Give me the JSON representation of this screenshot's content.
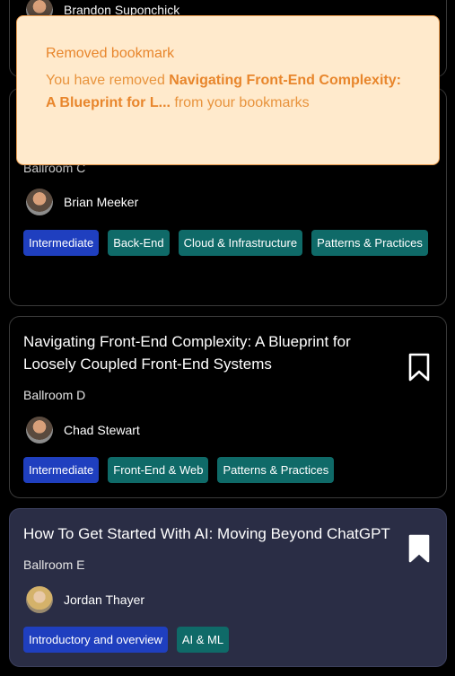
{
  "top_card": {
    "speaker": "Brandon Suponchick"
  },
  "card2": {
    "room": "Ballroom C",
    "speaker": "Brian Meeker",
    "tags": [
      {
        "label": "Intermediate",
        "color": "blue"
      },
      {
        "label": "Back-End",
        "color": "teal"
      },
      {
        "label": "Cloud & Infrastructure",
        "color": "teal"
      },
      {
        "label": "Patterns & Practices",
        "color": "teal"
      }
    ]
  },
  "card3": {
    "title": "Navigating Front-End Complexity: A Blueprint for Loosely Coupled Front-End Systems",
    "room": "Ballroom D",
    "speaker": "Chad Stewart",
    "bookmarked": false,
    "tags": [
      {
        "label": "Intermediate",
        "color": "blue"
      },
      {
        "label": "Front-End & Web",
        "color": "teal"
      },
      {
        "label": "Patterns & Practices",
        "color": "teal"
      }
    ]
  },
  "card4": {
    "title": "How To Get Started With AI: Moving Beyond ChatGPT",
    "room": "Ballroom E",
    "speaker": "Jordan Thayer",
    "bookmarked": true,
    "tags": [
      {
        "label": "Introductory and overview",
        "color": "blue"
      },
      {
        "label": "AI & ML",
        "color": "teal"
      }
    ]
  },
  "toast": {
    "title": "Removed bookmark",
    "body_prefix": "You have removed ",
    "body_bold": "Navigating Front-End Complexity: A Blueprint for L...",
    "body_suffix": " from your bookmarks"
  },
  "colors": {
    "tag_blue": "#1f3fbf",
    "tag_teal": "#0f6a68",
    "toast_bg": "#ffeacc",
    "toast_text": "#e8862c"
  }
}
